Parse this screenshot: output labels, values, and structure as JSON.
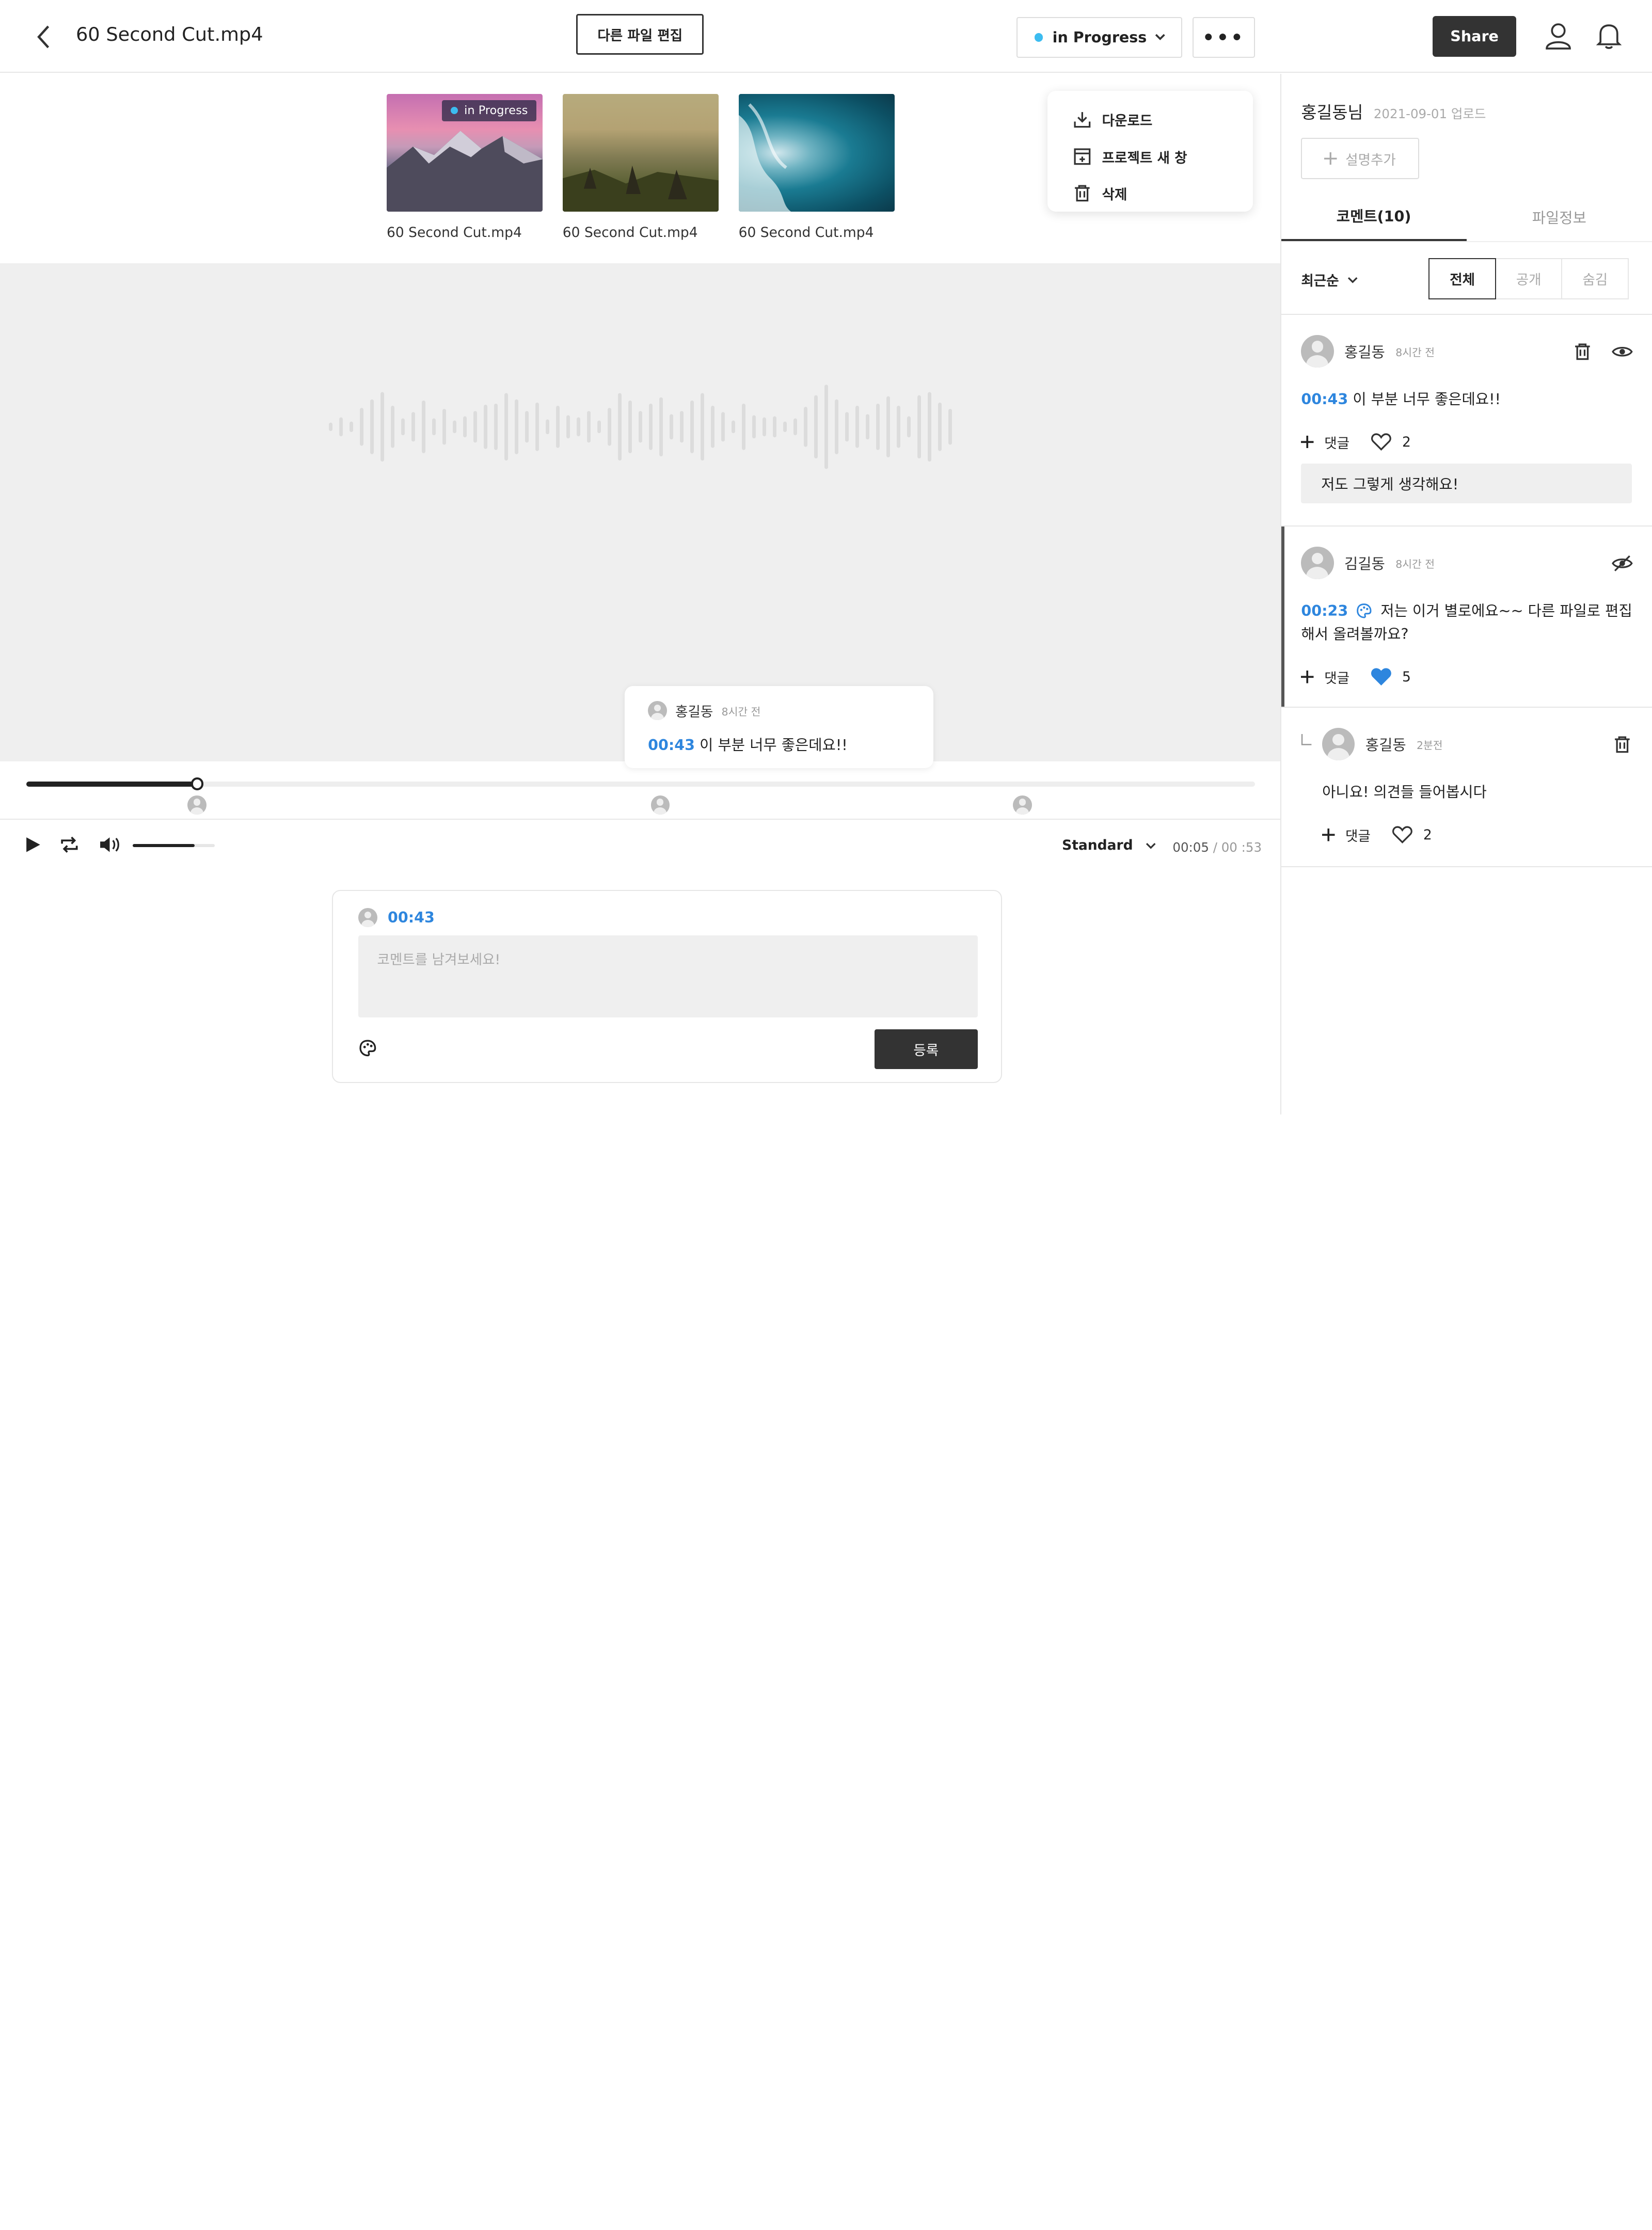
{
  "header": {
    "file_title": "60 Second Cut.mp4",
    "edit_other_label": "다른 파일 편집",
    "status_label": "in Progress",
    "status_color": "#3cbcf0",
    "more_label": "•••",
    "share_label": "Share"
  },
  "thumbnails": [
    {
      "caption": "60 Second Cut.mp4",
      "badge": "in Progress"
    },
    {
      "caption": "60 Second Cut.mp4"
    },
    {
      "caption": "60 Second Cut.mp4"
    }
  ],
  "menu": {
    "items": [
      {
        "label": "다운로드",
        "icon": "download-icon"
      },
      {
        "label": "프로젝트 새 창",
        "icon": "new-window-icon"
      },
      {
        "label": "삭제",
        "icon": "trash-icon"
      }
    ]
  },
  "popup": {
    "author": "홍길동",
    "time": "8시간 전",
    "timecode": "00:43",
    "text": "이 부분 너무 좋은데요!!"
  },
  "player": {
    "progress": 0.139,
    "volume": 0.75,
    "speed": "Standard",
    "current_time": "00:05",
    "total_time": "/ 00 :53",
    "markers": [
      0.139,
      0.516,
      0.811
    ]
  },
  "comment_box": {
    "timecode": "00:43",
    "placeholder": "코멘트를 남겨보세요!",
    "submit_label": "등록"
  },
  "sidebar": {
    "uploader": "홍길동님",
    "upload_date": "2021-09-01 업로드",
    "add_desc_label": "설명추가",
    "tab_comments": "코멘트(10)",
    "tab_fileinfo": "파일정보",
    "sort_label": "최근순",
    "filters": [
      "전체",
      "공개",
      "숨김"
    ],
    "comments": [
      {
        "author": "홍길동",
        "time": "8시간 전",
        "timecode": "00:43",
        "text": "이 부분 너무 좋은데요!!",
        "reply_label": "댓글",
        "likes": "2",
        "reply_text": "저도 그렇게 생각해요!"
      },
      {
        "author": "김길동",
        "time": "8시간 전",
        "timecode": "00:23",
        "text": "저는 이거 별로에요~~ 다른 파일로 편집해서 올려볼까요?",
        "reply_label": "댓글",
        "likes": "5"
      },
      {
        "author": "홍길동",
        "time": "2분전",
        "text": "아니요! 의견들 들어봅시다",
        "reply_label": "댓글",
        "likes": "2"
      }
    ]
  },
  "colors": {
    "accent": "#2e86de",
    "dark": "#333333",
    "like_active": "#2e86de"
  }
}
